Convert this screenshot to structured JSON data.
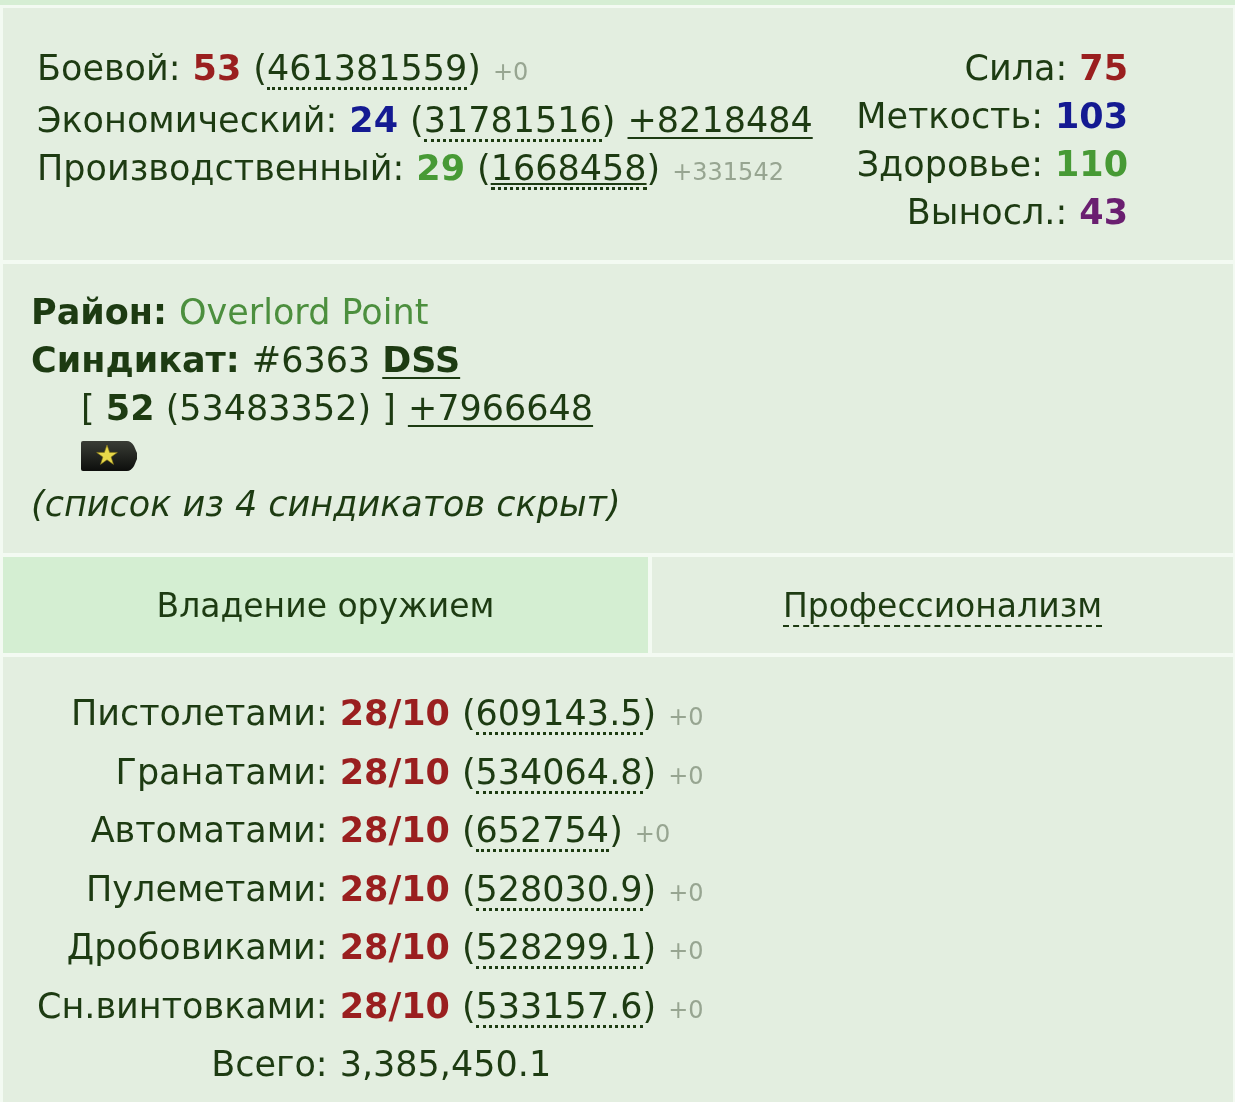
{
  "skills": [
    {
      "name": "Боевой:",
      "rank": "53",
      "color": "#9a1f1f",
      "paren_open": "(",
      "exp": "461381559",
      "paren_close": ")",
      "exp_link": false,
      "gain": "+0",
      "kind": "note"
    },
    {
      "name": "Экономический:",
      "rank": "24",
      "color": "#141a92",
      "paren_open": "(",
      "exp": "31781516",
      "paren_close": ")",
      "exp_link": false,
      "gain": "+8218484",
      "kind": "link"
    },
    {
      "name": "Производственный:",
      "rank": "29",
      "color": "#479a35",
      "paren_open": "(",
      "exp": "1668458",
      "paren_close": ")",
      "exp_link": true,
      "gain": "+331542",
      "kind": "note"
    }
  ],
  "stats": [
    {
      "name": "Сила:",
      "value": "75",
      "color": "#9a1f1f"
    },
    {
      "name": "Меткость:",
      "value": "103",
      "color": "#141a92"
    },
    {
      "name": "Здоровье:",
      "value": "110",
      "color": "#479a35"
    },
    {
      "name": "Выносл.:",
      "value": "43",
      "color": "#6a1f70"
    }
  ],
  "district": {
    "label": "Район:",
    "name": "Overlord Point"
  },
  "syndicate": {
    "label": "Синдикат:",
    "number": "#6363",
    "name": "DSS",
    "summary": "[ **52** (53483352) ]",
    "gain": "+7966648",
    "note": "(список из 4 синдикатов скрыт)"
  },
  "tabs": [
    {
      "label": "Владение оружием",
      "selected": true
    },
    {
      "label": "Профессионализм",
      "selected": false
    }
  ],
  "weapons": [
    {
      "name": "Пистолетами:",
      "rank": "28/10",
      "paren_open": "(",
      "exp": "609143.5",
      "paren_close": ")",
      "gain": "+0"
    },
    {
      "name": "Гранатами:",
      "rank": "28/10",
      "paren_open": "(",
      "exp": "534064.8",
      "paren_close": ")",
      "gain": "+0"
    },
    {
      "name": "Автоматами:",
      "rank": "28/10",
      "paren_open": "(",
      "exp": "652754",
      "paren_close": ")",
      "gain": "+0"
    },
    {
      "name": "Пулеметами:",
      "rank": "28/10",
      "paren_open": "(",
      "exp": "528030.9",
      "paren_close": ")",
      "gain": "+0"
    },
    {
      "name": "Дробовиками:",
      "rank": "28/10",
      "paren_open": "(",
      "exp": "528299.1",
      "paren_close": ")",
      "gain": "+0"
    },
    {
      "name": "Сн.винтовками:",
      "rank": "28/10",
      "paren_open": "(",
      "exp": "533157.6",
      "paren_close": ")",
      "gain": "+0"
    }
  ],
  "total": {
    "label": "Всего:",
    "value": "3,385,450.1"
  }
}
